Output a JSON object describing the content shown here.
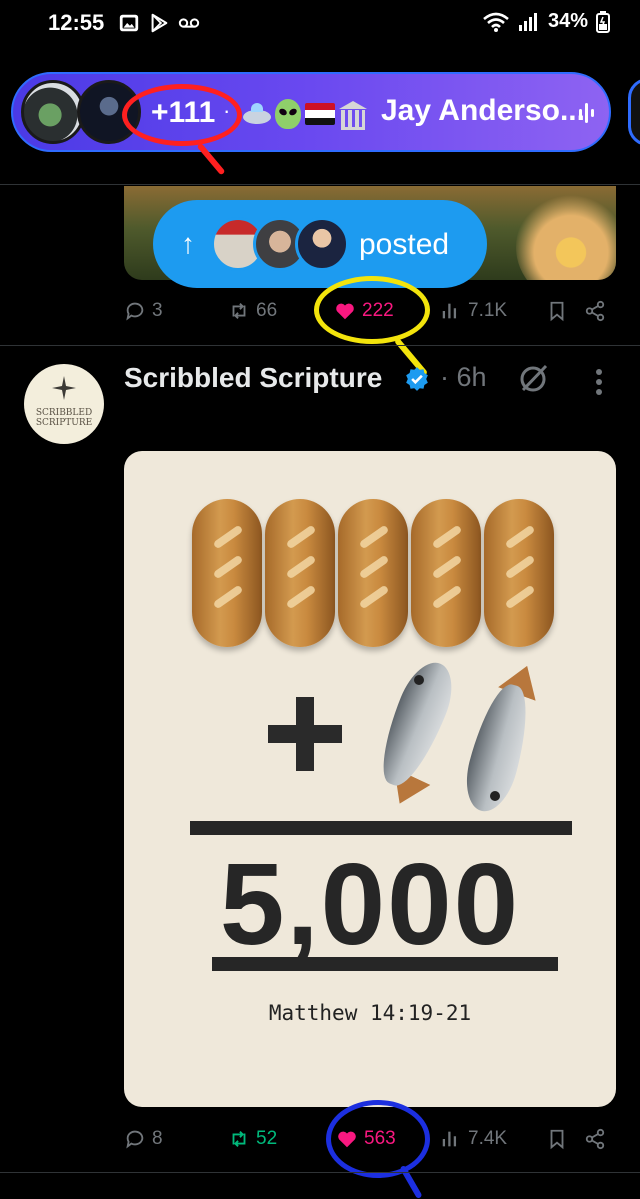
{
  "status_bar": {
    "time": "12:55",
    "battery": "34%"
  },
  "spaces": {
    "listener_count": "+111",
    "separator": "·",
    "host_name": "Jay Anderso...",
    "emojis": [
      "ufo",
      "alien",
      "egypt-flag",
      "classical-building"
    ]
  },
  "previous_post": {
    "posted_label": "posted",
    "actions": {
      "replies": "3",
      "reposts": "66",
      "likes": "222",
      "views": "7.1K"
    }
  },
  "post": {
    "author_name": "Scribbled Scripture",
    "time_separator": "·",
    "time": "6h",
    "avatar_text": "SCRIBBLED SCRIPTURE",
    "image": {
      "equation_result": "5,000",
      "verse": "Matthew 14:19-21",
      "loaf_count": 5,
      "fish_count": 2
    },
    "actions": {
      "replies": "8",
      "reposts": "52",
      "likes": "563",
      "views": "7.4K"
    }
  },
  "colors": {
    "background": "#000000",
    "accent_blue": "#1d9bf0",
    "like_pink": "#f91880",
    "repost_green": "#00ba7c",
    "muted": "#71767b",
    "spaces_gradient_start": "#4b3ae6",
    "spaces_gradient_end": "#8e63f2",
    "annotation_red": "#ff2020",
    "annotation_yellow": "#f3e40c",
    "annotation_blue": "#1c2fe0"
  },
  "icons": [
    "image-icon",
    "play-store-icon",
    "voicemail-icon",
    "wifi-icon",
    "signal-icon",
    "battery-icon",
    "reply-icon",
    "repost-icon",
    "heart-icon",
    "views-icon",
    "bookmark-icon",
    "share-icon",
    "verified-icon",
    "grok-icon",
    "more-icon"
  ]
}
